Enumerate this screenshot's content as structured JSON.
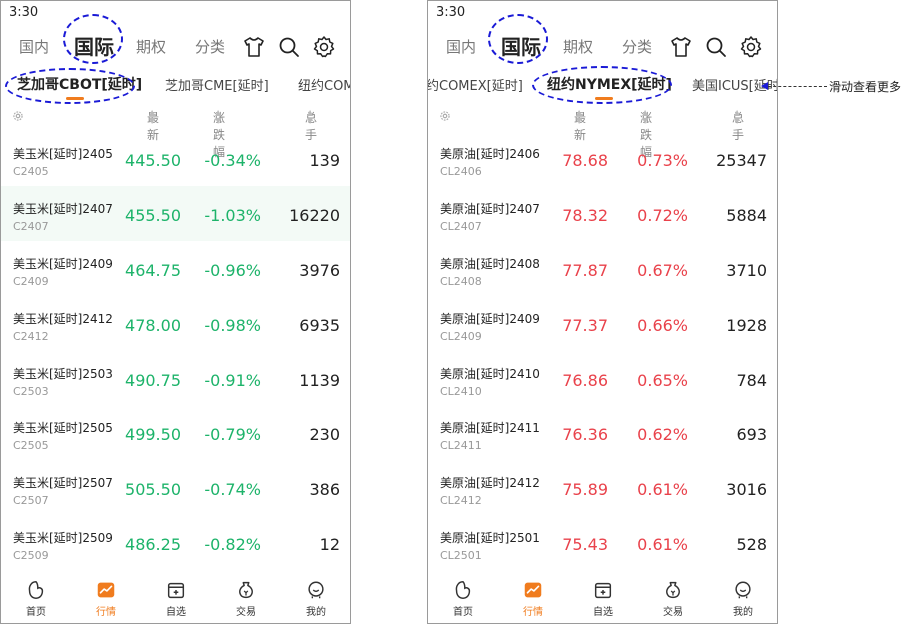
{
  "screens": [
    {
      "status_time": "3:30",
      "top_tabs": [
        "国内",
        "国际",
        "期权",
        "分类"
      ],
      "exchange_tabs": [
        "芝加哥CBOT[延时]",
        "芝加哥CME[延时]",
        "纽约COM"
      ],
      "headers": {
        "price": "最新",
        "change": "涨跌幅",
        "volume": "总手"
      },
      "rows": [
        {
          "name": "美玉米[延时]2405",
          "code": "C2405",
          "price": "445.50",
          "change": "-0.34%",
          "volume": "139"
        },
        {
          "name": "美玉米[延时]2407",
          "code": "C2407",
          "price": "455.50",
          "change": "-1.03%",
          "volume": "16220"
        },
        {
          "name": "美玉米[延时]2409",
          "code": "C2409",
          "price": "464.75",
          "change": "-0.96%",
          "volume": "3976"
        },
        {
          "name": "美玉米[延时]2412",
          "code": "C2412",
          "price": "478.00",
          "change": "-0.98%",
          "volume": "6935"
        },
        {
          "name": "美玉米[延时]2503",
          "code": "C2503",
          "price": "490.75",
          "change": "-0.91%",
          "volume": "1139"
        },
        {
          "name": "美玉米[延时]2505",
          "code": "C2505",
          "price": "499.50",
          "change": "-0.79%",
          "volume": "230"
        },
        {
          "name": "美玉米[延时]2507",
          "code": "C2507",
          "price": "505.50",
          "change": "-0.74%",
          "volume": "386"
        },
        {
          "name": "美玉米[延时]2509",
          "code": "C2509",
          "price": "486.25",
          "change": "-0.82%",
          "volume": "12"
        }
      ],
      "nav": [
        "首页",
        "行情",
        "自选",
        "交易",
        "我的"
      ]
    },
    {
      "status_time": "3:30",
      "top_tabs": [
        "国内",
        "国际",
        "期权",
        "分类"
      ],
      "exchange_tabs": [
        "约COMEX[延时]",
        "纽约NYMEX[延时]",
        "美国ICUS[延时"
      ],
      "headers": {
        "price": "最新",
        "change": "涨跌幅",
        "volume": "总手"
      },
      "rows": [
        {
          "name": "美原油[延时]2406",
          "code": "CL2406",
          "price": "78.68",
          "change": "0.73%",
          "volume": "25347"
        },
        {
          "name": "美原油[延时]2407",
          "code": "CL2407",
          "price": "78.32",
          "change": "0.72%",
          "volume": "5884"
        },
        {
          "name": "美原油[延时]2408",
          "code": "CL2408",
          "price": "77.87",
          "change": "0.67%",
          "volume": "3710"
        },
        {
          "name": "美原油[延时]2409",
          "code": "CL2409",
          "price": "77.37",
          "change": "0.66%",
          "volume": "1928"
        },
        {
          "name": "美原油[延时]2410",
          "code": "CL2410",
          "price": "76.86",
          "change": "0.65%",
          "volume": "784"
        },
        {
          "name": "美原油[延时]2411",
          "code": "CL2411",
          "price": "76.36",
          "change": "0.62%",
          "volume": "693"
        },
        {
          "name": "美原油[延时]2412",
          "code": "CL2412",
          "price": "75.89",
          "change": "0.61%",
          "volume": "3016"
        },
        {
          "name": "美原油[延时]2501",
          "code": "CL2501",
          "price": "75.43",
          "change": "0.61%",
          "volume": "528"
        }
      ],
      "nav": [
        "首页",
        "行情",
        "自选",
        "交易",
        "我的"
      ]
    }
  ],
  "annotation": "滑动查看更多",
  "colors": {
    "down": "#1db36a",
    "up": "#e9424b",
    "accent": "#f07c1e",
    "annotation": "#1a1ad6"
  },
  "icons": [
    "tshirt-icon",
    "search-icon",
    "gear-icon",
    "home-icon",
    "market-icon",
    "watchlist-icon",
    "trade-icon",
    "profile-icon"
  ]
}
